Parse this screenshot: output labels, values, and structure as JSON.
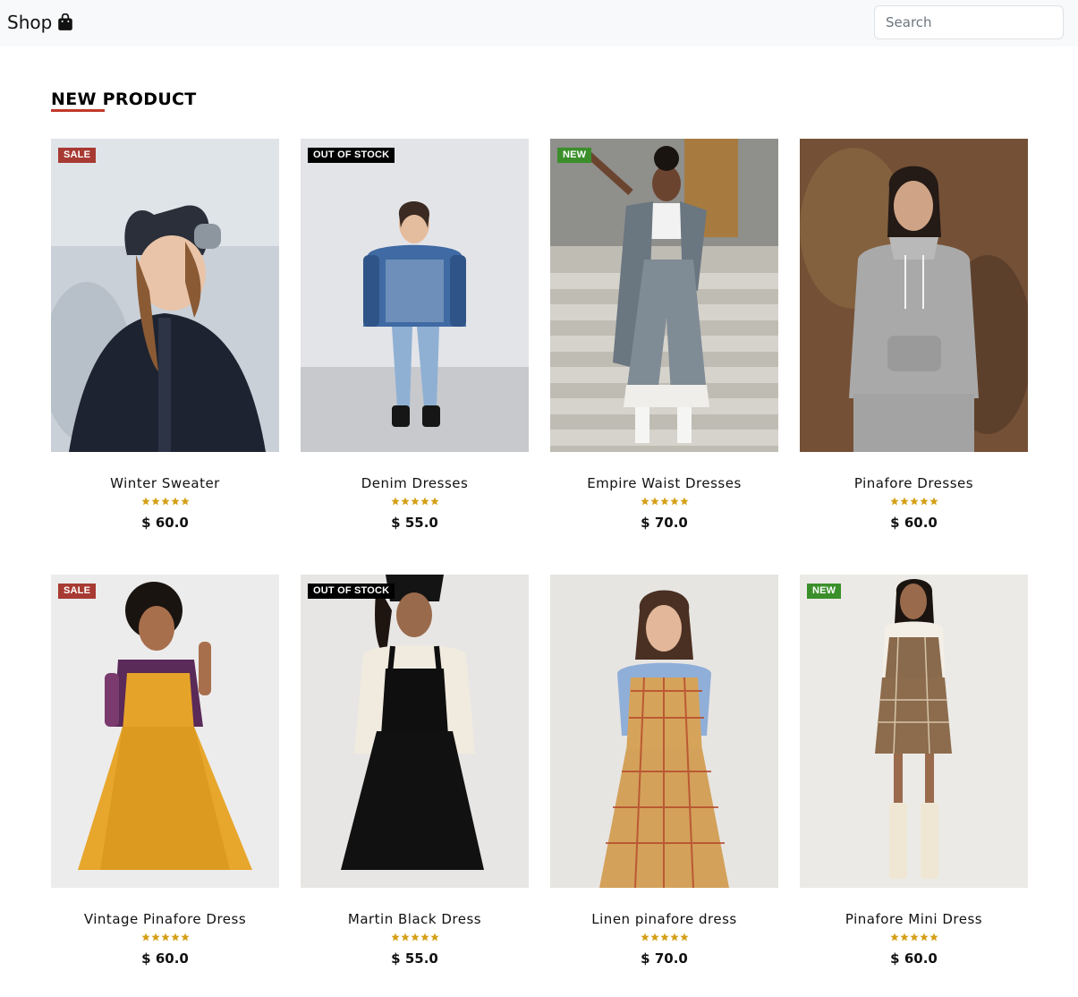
{
  "navbar": {
    "brand": "Shop",
    "search_placeholder": "Search",
    "search_value": ""
  },
  "section": {
    "title": "NEW PRODUCT"
  },
  "colors": {
    "accent_underline": "#c0392b",
    "badge_sale": "#a73a32",
    "badge_out_of_stock": "#000000",
    "badge_new": "#3a8f2a",
    "star": "#d4a017"
  },
  "products": [
    {
      "name": "Winter Sweater",
      "price": "$ 60.0",
      "badge": "SALE",
      "badge_type": "sale",
      "rating": 5,
      "image": "woman-black-coat-snow-photo"
    },
    {
      "name": "Denim Dresses",
      "price": "$ 55.0",
      "badge": "OUT OF STOCK",
      "badge_type": "oos",
      "rating": 5,
      "image": "denim-puffer-jacket-photo"
    },
    {
      "name": "Empire Waist Dresses",
      "price": "$ 70.0",
      "badge": "NEW",
      "badge_type": "new",
      "rating": 5,
      "image": "grey-suit-stairs-photo"
    },
    {
      "name": "Pinafore Dresses",
      "price": "$ 60.0",
      "badge": "",
      "badge_type": "",
      "rating": 5,
      "image": "grey-hoodie-photo"
    },
    {
      "name": "Vintage Pinafore Dress",
      "price": "$ 60.0",
      "badge": "SALE",
      "badge_type": "sale",
      "rating": 5,
      "image": "mustard-pinafore-dress-photo"
    },
    {
      "name": "Martin Black Dress",
      "price": "$ 55.0",
      "badge": "OUT OF STOCK",
      "badge_type": "oos",
      "rating": 5,
      "image": "black-corduroy-pinafore-photo"
    },
    {
      "name": "Linen pinafore dress",
      "price": "$ 70.0",
      "badge": "",
      "badge_type": "",
      "rating": 5,
      "image": "plaid-pinafore-dress-photo"
    },
    {
      "name": "Pinafore Mini Dress",
      "price": "$ 60.0",
      "badge": "NEW",
      "badge_type": "new",
      "rating": 5,
      "image": "plaid-mini-pinafore-photo"
    }
  ]
}
